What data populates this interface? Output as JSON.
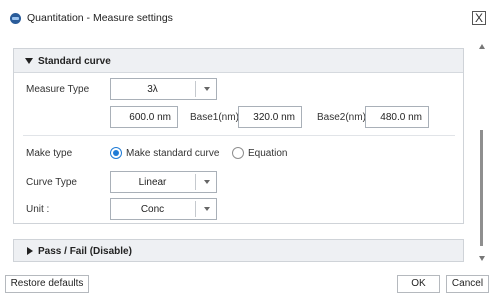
{
  "window": {
    "title": "Quantitation - Measure settings",
    "close_glyph": "X",
    "icon": "app-logo-icon"
  },
  "standard_curve": {
    "header": "Standard curve",
    "measure_type": {
      "label": "Measure Type",
      "value": "3λ"
    },
    "wavelength": {
      "value": "600.0 nm"
    },
    "base1": {
      "label": "Base1(nm):",
      "value": "320.0 nm"
    },
    "base2": {
      "label": "Base2(nm):",
      "value": "480.0 nm"
    },
    "make_type": {
      "label": "Make type",
      "options": [
        {
          "label": "Make standard curve",
          "selected": true
        },
        {
          "label": "Equation",
          "selected": false
        }
      ]
    },
    "curve_type": {
      "label": "Curve Type",
      "value": "Linear"
    },
    "unit": {
      "label": "Unit :",
      "value": "Conc"
    }
  },
  "pass_fail": {
    "header": "Pass / Fail (Disable)"
  },
  "footer": {
    "restore": "Restore defaults",
    "ok": "OK",
    "cancel": "Cancel"
  },
  "colors": {
    "accent": "#1f7bd6",
    "panel_header": "#eef0f3",
    "border": "#cfd3d8"
  }
}
